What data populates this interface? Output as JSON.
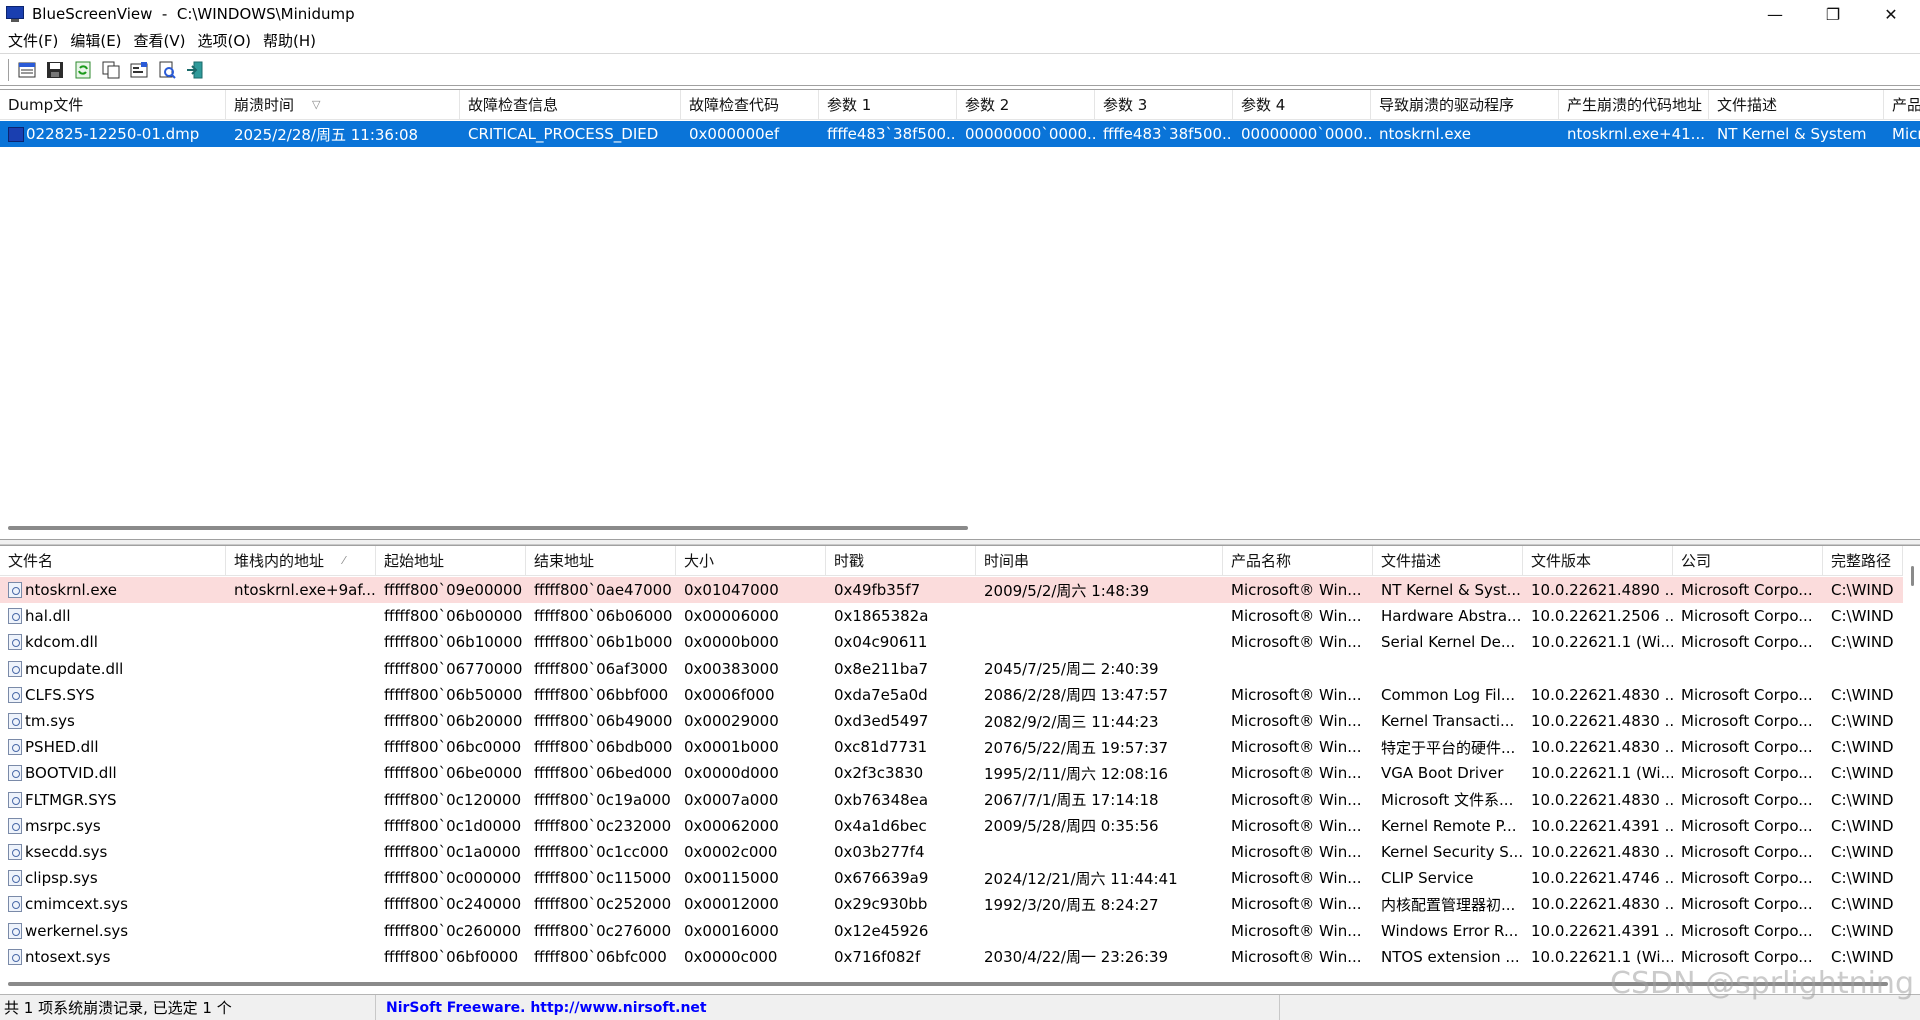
{
  "window": {
    "title": "BlueScreenView  -  C:\\WINDOWS\\Minidump",
    "minimize": "—",
    "maximize": "❐",
    "close": "✕"
  },
  "menu": [
    "文件(F)",
    "编辑(E)",
    "查看(V)",
    "选项(O)",
    "帮助(H)"
  ],
  "toolbar": [
    "html-report-icon",
    "save-icon",
    "refresh-icon",
    "copy-icon",
    "properties-icon",
    "find-icon",
    "exit-icon"
  ],
  "top_table": {
    "columns": [
      "Dump文件",
      "崩溃时间",
      "故障检查信息",
      "故障检查代码",
      "参数 1",
      "参数 2",
      "参数 3",
      "参数 4",
      "导致崩溃的驱动程序",
      "产生崩溃的代码地址",
      "文件描述",
      "产品"
    ],
    "rows": [
      [
        "022825-12250-01.dmp",
        "2025/2/28/周五 11:36:08",
        "CRITICAL_PROCESS_DIED",
        "0x000000ef",
        "ffffe483`38f500...",
        "00000000`0000...",
        "ffffe483`38f500...",
        "00000000`0000...",
        "ntoskrnl.exe",
        "ntoskrnl.exe+41...",
        "NT Kernel & System",
        "Micr"
      ]
    ]
  },
  "bottom_table": {
    "columns": [
      "文件名",
      "堆栈内的地址",
      "起始地址",
      "结束地址",
      "大小",
      "时戳",
      "时间串",
      "产品名称",
      "文件描述",
      "文件版本",
      "公司",
      "完整路径"
    ],
    "rows": [
      [
        "ntoskrnl.exe",
        "ntoskrnl.exe+9af...",
        "fffff800`09e00000",
        "fffff800`0ae47000",
        "0x01047000",
        "0x49fb35f7",
        "2009/5/2/周六 1:48:39",
        "Microsoft® Win...",
        "NT Kernel & Syst...",
        "10.0.22621.4890 ...",
        "Microsoft Corpo...",
        "C:\\WIND"
      ],
      [
        "hal.dll",
        "",
        "fffff800`06b00000",
        "fffff800`06b06000",
        "0x00006000",
        "0x1865382a",
        "",
        "Microsoft® Win...",
        "Hardware Abstra...",
        "10.0.22621.2506 ...",
        "Microsoft Corpo...",
        "C:\\WIND"
      ],
      [
        "kdcom.dll",
        "",
        "fffff800`06b10000",
        "fffff800`06b1b000",
        "0x0000b000",
        "0x04c90611",
        "",
        "Microsoft® Win...",
        "Serial Kernel De...",
        "10.0.22621.1 (Wi...",
        "Microsoft Corpo...",
        "C:\\WIND"
      ],
      [
        "mcupdate.dll",
        "",
        "fffff800`06770000",
        "fffff800`06af3000",
        "0x00383000",
        "0x8e211ba7",
        "2045/7/25/周二 2:40:39",
        "",
        "",
        "",
        "",
        ""
      ],
      [
        "CLFS.SYS",
        "",
        "fffff800`06b50000",
        "fffff800`06bbf000",
        "0x0006f000",
        "0xda7e5a0d",
        "2086/2/28/周四 13:47:57",
        "Microsoft® Win...",
        "Common Log Fil...",
        "10.0.22621.4830 ...",
        "Microsoft Corpo...",
        "C:\\WIND"
      ],
      [
        "tm.sys",
        "",
        "fffff800`06b20000",
        "fffff800`06b49000",
        "0x00029000",
        "0xd3ed5497",
        "2082/9/2/周三 11:44:23",
        "Microsoft® Win...",
        "Kernel Transacti...",
        "10.0.22621.4830 ...",
        "Microsoft Corpo...",
        "C:\\WIND"
      ],
      [
        "PSHED.dll",
        "",
        "fffff800`06bc0000",
        "fffff800`06bdb000",
        "0x0001b000",
        "0xc81d7731",
        "2076/5/22/周五 19:57:37",
        "Microsoft® Win...",
        "特定于平台的硬件...",
        "10.0.22621.4830 ...",
        "Microsoft Corpo...",
        "C:\\WIND"
      ],
      [
        "BOOTVID.dll",
        "",
        "fffff800`06be0000",
        "fffff800`06bed000",
        "0x0000d000",
        "0x2f3c3830",
        "1995/2/11/周六 12:08:16",
        "Microsoft® Win...",
        "VGA Boot Driver",
        "10.0.22621.1 (Wi...",
        "Microsoft Corpo...",
        "C:\\WIND"
      ],
      [
        "FLTMGR.SYS",
        "",
        "fffff800`0c120000",
        "fffff800`0c19a000",
        "0x0007a000",
        "0xb76348ea",
        "2067/7/1/周五 17:14:18",
        "Microsoft® Win...",
        "Microsoft 文件系...",
        "10.0.22621.4830 ...",
        "Microsoft Corpo...",
        "C:\\WIND"
      ],
      [
        "msrpc.sys",
        "",
        "fffff800`0c1d0000",
        "fffff800`0c232000",
        "0x00062000",
        "0x4a1d6bec",
        "2009/5/28/周四 0:35:56",
        "Microsoft® Win...",
        "Kernel Remote P...",
        "10.0.22621.4391 ...",
        "Microsoft Corpo...",
        "C:\\WIND"
      ],
      [
        "ksecdd.sys",
        "",
        "fffff800`0c1a0000",
        "fffff800`0c1cc000",
        "0x0002c000",
        "0x03b277f4",
        "",
        "Microsoft® Win...",
        "Kernel Security S...",
        "10.0.22621.4830 ...",
        "Microsoft Corpo...",
        "C:\\WIND"
      ],
      [
        "clipsp.sys",
        "",
        "fffff800`0c000000",
        "fffff800`0c115000",
        "0x00115000",
        "0x676639a9",
        "2024/12/21/周六 11:44:41",
        "Microsoft® Win...",
        "CLIP Service",
        "10.0.22621.4746 ...",
        "Microsoft Corpo...",
        "C:\\WIND"
      ],
      [
        "cmimcext.sys",
        "",
        "fffff800`0c240000",
        "fffff800`0c252000",
        "0x00012000",
        "0x29c930bb",
        "1992/3/20/周五 8:24:27",
        "Microsoft® Win...",
        "内核配置管理器初...",
        "10.0.22621.4830 ...",
        "Microsoft Corpo...",
        "C:\\WIND"
      ],
      [
        "werkernel.sys",
        "",
        "fffff800`0c260000",
        "fffff800`0c276000",
        "0x00016000",
        "0x12e45926",
        "",
        "Microsoft® Win...",
        "Windows Error R...",
        "10.0.22621.4391 ...",
        "Microsoft Corpo...",
        "C:\\WIND"
      ],
      [
        "ntosext.sys",
        "",
        "fffff800`06bf0000",
        "fffff800`06bfc000",
        "0x0000c000",
        "0x716f082f",
        "2030/4/22/周一 23:26:39",
        "Microsoft® Win...",
        "NTOS extension ...",
        "10.0.22621.1 (Wi...",
        "Microsoft Corpo...",
        "C:\\WIND"
      ]
    ]
  },
  "status": {
    "summary": "共 1 项系统崩溃记录, 已选定 1 个",
    "link": "NirSoft Freeware.  http://www.nirsoft.net"
  },
  "watermark": "CSDN @sprlightning",
  "colors": {
    "selection": "#0a74d8",
    "highlight_row": "#fbdcdc",
    "link": "#0000ff"
  }
}
